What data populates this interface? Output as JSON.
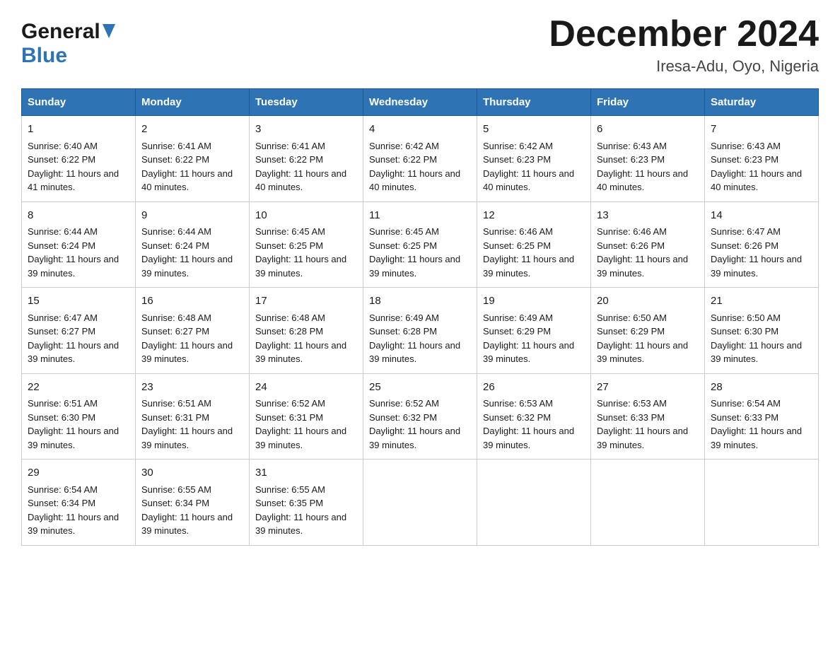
{
  "header": {
    "logo_general": "General",
    "logo_blue": "Blue",
    "title": "December 2024",
    "subtitle": "Iresa-Adu, Oyo, Nigeria"
  },
  "days_of_week": [
    "Sunday",
    "Monday",
    "Tuesday",
    "Wednesday",
    "Thursday",
    "Friday",
    "Saturday"
  ],
  "weeks": [
    [
      {
        "day": "1",
        "sunrise": "6:40 AM",
        "sunset": "6:22 PM",
        "daylight": "11 hours and 41 minutes."
      },
      {
        "day": "2",
        "sunrise": "6:41 AM",
        "sunset": "6:22 PM",
        "daylight": "11 hours and 40 minutes."
      },
      {
        "day": "3",
        "sunrise": "6:41 AM",
        "sunset": "6:22 PM",
        "daylight": "11 hours and 40 minutes."
      },
      {
        "day": "4",
        "sunrise": "6:42 AM",
        "sunset": "6:22 PM",
        "daylight": "11 hours and 40 minutes."
      },
      {
        "day": "5",
        "sunrise": "6:42 AM",
        "sunset": "6:23 PM",
        "daylight": "11 hours and 40 minutes."
      },
      {
        "day": "6",
        "sunrise": "6:43 AM",
        "sunset": "6:23 PM",
        "daylight": "11 hours and 40 minutes."
      },
      {
        "day": "7",
        "sunrise": "6:43 AM",
        "sunset": "6:23 PM",
        "daylight": "11 hours and 40 minutes."
      }
    ],
    [
      {
        "day": "8",
        "sunrise": "6:44 AM",
        "sunset": "6:24 PM",
        "daylight": "11 hours and 39 minutes."
      },
      {
        "day": "9",
        "sunrise": "6:44 AM",
        "sunset": "6:24 PM",
        "daylight": "11 hours and 39 minutes."
      },
      {
        "day": "10",
        "sunrise": "6:45 AM",
        "sunset": "6:25 PM",
        "daylight": "11 hours and 39 minutes."
      },
      {
        "day": "11",
        "sunrise": "6:45 AM",
        "sunset": "6:25 PM",
        "daylight": "11 hours and 39 minutes."
      },
      {
        "day": "12",
        "sunrise": "6:46 AM",
        "sunset": "6:25 PM",
        "daylight": "11 hours and 39 minutes."
      },
      {
        "day": "13",
        "sunrise": "6:46 AM",
        "sunset": "6:26 PM",
        "daylight": "11 hours and 39 minutes."
      },
      {
        "day": "14",
        "sunrise": "6:47 AM",
        "sunset": "6:26 PM",
        "daylight": "11 hours and 39 minutes."
      }
    ],
    [
      {
        "day": "15",
        "sunrise": "6:47 AM",
        "sunset": "6:27 PM",
        "daylight": "11 hours and 39 minutes."
      },
      {
        "day": "16",
        "sunrise": "6:48 AM",
        "sunset": "6:27 PM",
        "daylight": "11 hours and 39 minutes."
      },
      {
        "day": "17",
        "sunrise": "6:48 AM",
        "sunset": "6:28 PM",
        "daylight": "11 hours and 39 minutes."
      },
      {
        "day": "18",
        "sunrise": "6:49 AM",
        "sunset": "6:28 PM",
        "daylight": "11 hours and 39 minutes."
      },
      {
        "day": "19",
        "sunrise": "6:49 AM",
        "sunset": "6:29 PM",
        "daylight": "11 hours and 39 minutes."
      },
      {
        "day": "20",
        "sunrise": "6:50 AM",
        "sunset": "6:29 PM",
        "daylight": "11 hours and 39 minutes."
      },
      {
        "day": "21",
        "sunrise": "6:50 AM",
        "sunset": "6:30 PM",
        "daylight": "11 hours and 39 minutes."
      }
    ],
    [
      {
        "day": "22",
        "sunrise": "6:51 AM",
        "sunset": "6:30 PM",
        "daylight": "11 hours and 39 minutes."
      },
      {
        "day": "23",
        "sunrise": "6:51 AM",
        "sunset": "6:31 PM",
        "daylight": "11 hours and 39 minutes."
      },
      {
        "day": "24",
        "sunrise": "6:52 AM",
        "sunset": "6:31 PM",
        "daylight": "11 hours and 39 minutes."
      },
      {
        "day": "25",
        "sunrise": "6:52 AM",
        "sunset": "6:32 PM",
        "daylight": "11 hours and 39 minutes."
      },
      {
        "day": "26",
        "sunrise": "6:53 AM",
        "sunset": "6:32 PM",
        "daylight": "11 hours and 39 minutes."
      },
      {
        "day": "27",
        "sunrise": "6:53 AM",
        "sunset": "6:33 PM",
        "daylight": "11 hours and 39 minutes."
      },
      {
        "day": "28",
        "sunrise": "6:54 AM",
        "sunset": "6:33 PM",
        "daylight": "11 hours and 39 minutes."
      }
    ],
    [
      {
        "day": "29",
        "sunrise": "6:54 AM",
        "sunset": "6:34 PM",
        "daylight": "11 hours and 39 minutes."
      },
      {
        "day": "30",
        "sunrise": "6:55 AM",
        "sunset": "6:34 PM",
        "daylight": "11 hours and 39 minutes."
      },
      {
        "day": "31",
        "sunrise": "6:55 AM",
        "sunset": "6:35 PM",
        "daylight": "11 hours and 39 minutes."
      },
      null,
      null,
      null,
      null
    ]
  ]
}
